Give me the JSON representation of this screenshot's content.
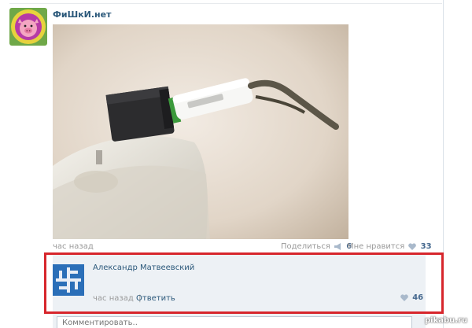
{
  "colors": {
    "accent": "#2b587a",
    "link": "#45688e",
    "muted": "#999999",
    "highlight": "#d7262c",
    "comments_bg": "#edf1f5"
  },
  "post": {
    "group_name": "ФиШкИ.нет",
    "time": "час назад",
    "share_label": "Поделиться",
    "share_count": "6",
    "like_label": "Мне нравится",
    "like_count": "33",
    "photo_icon": "usb-flash-drive-in-power-strip-photo"
  },
  "comment": {
    "author": "Александр Матвеевский",
    "text": "",
    "time": "час назад",
    "reply_label": "Ответить",
    "like_count": "46"
  },
  "comment_input": {
    "placeholder": "Комментировать.."
  },
  "watermark": "pikabu.ru"
}
